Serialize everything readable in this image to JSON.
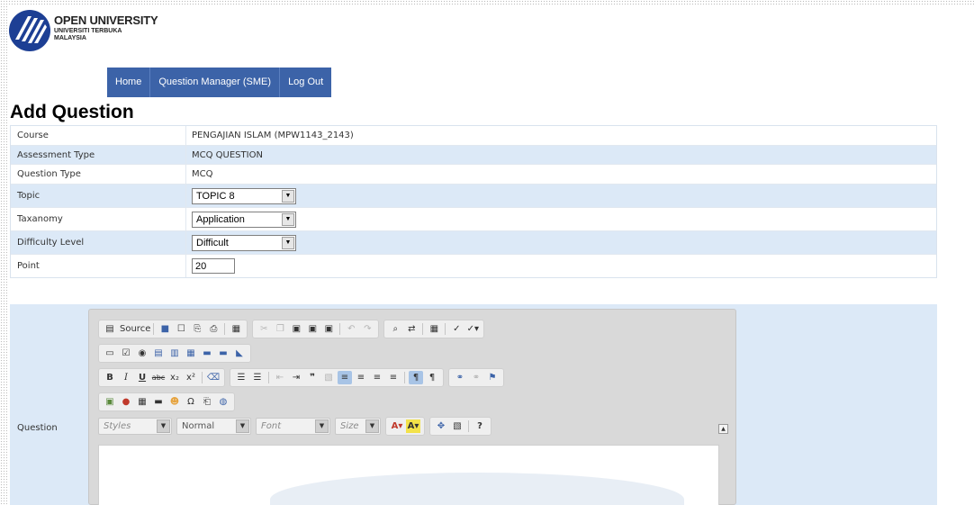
{
  "logo": {
    "line1": "OPEN UNIVERSITY",
    "line2": "UNIVERSITI TERBUKA",
    "line3": "MALAYSIA"
  },
  "nav": {
    "items": [
      {
        "label": "Home"
      },
      {
        "label": "Question Manager (SME)"
      },
      {
        "label": "Log Out"
      }
    ]
  },
  "page": {
    "title": "Add Question"
  },
  "form": {
    "course": {
      "label": "Course",
      "value": "PENGAJIAN ISLAM (MPW1143_2143)"
    },
    "assessment_type": {
      "label": "Assessment Type",
      "value": "MCQ QUESTION"
    },
    "question_type": {
      "label": "Question Type",
      "value": "MCQ"
    },
    "topic": {
      "label": "Topic",
      "value": "TOPIC 8"
    },
    "taxanomy": {
      "label": "Taxanomy",
      "value": "Application"
    },
    "difficulty": {
      "label": "Difficulty Level",
      "value": "Difficult"
    },
    "point": {
      "label": "Point",
      "value": "20"
    }
  },
  "question": {
    "label": "Question",
    "editor": {
      "source_label": "Source",
      "styles_placeholder": "Styles",
      "format_value": "Normal",
      "font_placeholder": "Font",
      "size_placeholder": "Size"
    }
  },
  "colors": {
    "nav_bg": "#3c63a8",
    "row_alt_bg": "#dce9f7",
    "logo_blue": "#1d3f94"
  }
}
